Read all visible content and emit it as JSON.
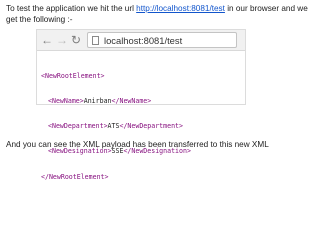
{
  "intro": {
    "text_before": "To test the application we hit the url ",
    "link": "http://localhost:8081/test",
    "text_after": " in our browser and we get the following :-"
  },
  "browser": {
    "back_icon": "back-arrow-icon",
    "forward_icon": "forward-arrow-icon",
    "reload_icon": "reload-icon",
    "url": "localhost:8081/test"
  },
  "xml": {
    "root_open": "<NewRootElement>",
    "name_open": "<NewName>",
    "name_value": "Anirban",
    "name_close": "</NewName>",
    "dept_open": "<NewDepartment>",
    "dept_value": "ATS",
    "dept_close": "</NewDepartment>",
    "desig_open": "<NewDesignation>",
    "desig_value": "SSE",
    "desig_close": "</NewDesignation>",
    "root_close": "</NewRootElement>"
  },
  "outro": {
    "text": "And you can see the XML payload has been transferred to this new XML"
  }
}
